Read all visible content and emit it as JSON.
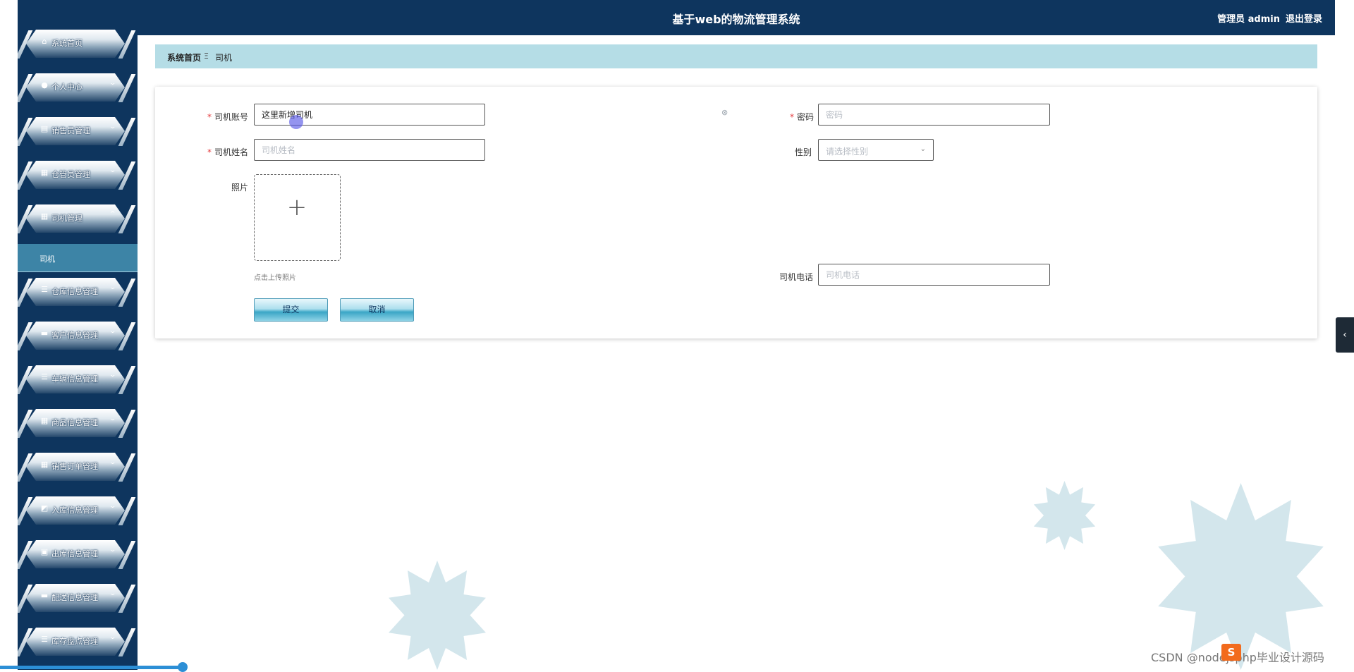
{
  "app": {
    "title": "基于web的物流管理系统",
    "user": "管理员 admin",
    "logout": "退出登录"
  },
  "sidebar": {
    "items": [
      {
        "label": "系统首页",
        "icon": "home-icon",
        "glyph": "⌂",
        "chevron": ""
      },
      {
        "label": "个人中心",
        "icon": "user-icon",
        "glyph": "●",
        "chevron": "⌄"
      },
      {
        "label": "销售员管理",
        "icon": "clipboard-icon",
        "glyph": "▤",
        "chevron": "⌄"
      },
      {
        "label": "仓管员管理",
        "icon": "grid-icon",
        "glyph": "▦",
        "chevron": "⌄"
      },
      {
        "label": "司机管理",
        "icon": "grid-icon",
        "glyph": "▦",
        "chevron": "⌃"
      },
      {
        "label": "仓库信息管理",
        "icon": "list-icon",
        "glyph": "☰",
        "chevron": "⌄"
      },
      {
        "label": "客户信息管理",
        "icon": "monitor-icon",
        "glyph": "▬",
        "chevron": "⌄"
      },
      {
        "label": "车辆信息管理",
        "icon": "list-icon",
        "glyph": "☰",
        "chevron": "⌄"
      },
      {
        "label": "商品信息管理",
        "icon": "grid-icon",
        "glyph": "▦",
        "chevron": "⌄"
      },
      {
        "label": "销售订单管理",
        "icon": "grid-icon",
        "glyph": "▦",
        "chevron": "⌄"
      },
      {
        "label": "入库信息管理",
        "icon": "chart-icon",
        "glyph": "◩",
        "chevron": "⌄"
      },
      {
        "label": "出库信息管理",
        "icon": "briefcase-icon",
        "glyph": "▣",
        "chevron": "⌄"
      },
      {
        "label": "配送信息管理",
        "icon": "monitor-icon",
        "glyph": "▬",
        "chevron": "⌄"
      },
      {
        "label": "库存盘点管理",
        "icon": "list-icon",
        "glyph": "☰",
        "chevron": "⌄"
      }
    ],
    "active_sub": "司机"
  },
  "breadcrumb": {
    "home": "系统首页",
    "separator": "Ξ",
    "current": "司机"
  },
  "form": {
    "account": {
      "label": "司机账号",
      "value": "这里新增司机"
    },
    "password": {
      "label": "密码",
      "placeholder": "密码"
    },
    "name": {
      "label": "司机姓名",
      "placeholder": "司机姓名"
    },
    "gender": {
      "label": "性别",
      "placeholder": "请选择性别"
    },
    "photo": {
      "label": "照片",
      "tip": "点击上传照片"
    },
    "phone": {
      "label": "司机电话",
      "placeholder": "司机电话"
    },
    "submit": "提交",
    "cancel": "取消"
  },
  "watermark": {
    "text": "CSDN @nodejsphp毕业设计源码",
    "logo": "S"
  },
  "progress": {
    "fraction": 0.137
  },
  "colors": {
    "header": "#0e355e",
    "breadcrumb_bg": "#b5dde6",
    "active_sub": "#3d84a6",
    "decoration": "#d3e6ec"
  }
}
